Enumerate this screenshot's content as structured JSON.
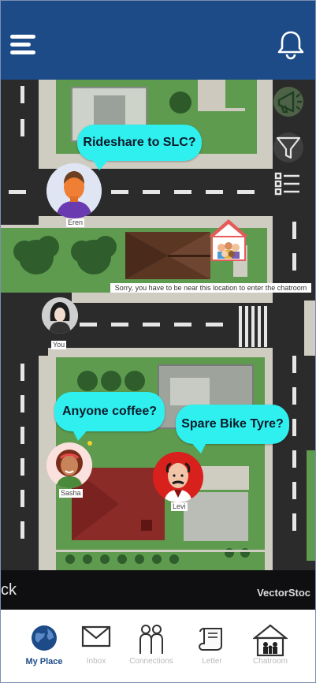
{
  "header": {
    "menu_icon": "hamburger-menu-icon",
    "notification_icon": "bell-icon"
  },
  "map": {
    "side_buttons": [
      {
        "icon": "megaphone-icon"
      },
      {
        "icon": "filter-icon"
      },
      {
        "icon": "list-icon"
      }
    ],
    "warning_text": "Sorry, you have to be near this location to enter the chatroom",
    "bubbles": {
      "rideshare": "Rideshare to SLC?",
      "coffee": "Anyone coffee?",
      "bike": "Spare Bike Tyre?"
    },
    "users": {
      "eren": "Eren",
      "you": "You",
      "sasha": "Sasha",
      "levi": "Levi"
    },
    "colors": {
      "bubble": "#2ff0ee",
      "header": "#1d4b87",
      "grass": "#5d9a4f",
      "road": "#2e2e2e"
    }
  },
  "watermark": {
    "left": "ck",
    "right": "VectorStoc"
  },
  "nav": {
    "items": [
      {
        "label": "My Place",
        "active": true
      },
      {
        "label": "Inbox"
      },
      {
        "label": "Connections"
      },
      {
        "label": "Letter"
      },
      {
        "label": "Chatroom"
      }
    ]
  }
}
